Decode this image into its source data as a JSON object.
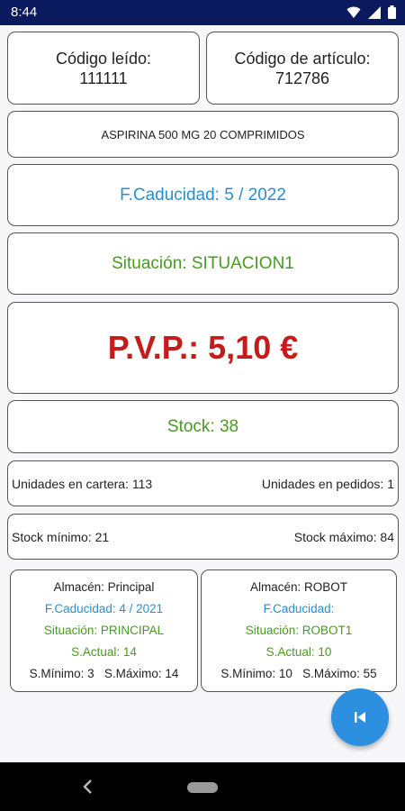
{
  "status_bar": {
    "time": "8:44",
    "icons": [
      "wifi-icon",
      "signal-icon",
      "battery-icon"
    ]
  },
  "codigo_leido": {
    "label": "Código leído:",
    "value": "111111"
  },
  "codigo_articulo": {
    "label": "Código de artículo:",
    "value": "712786"
  },
  "description": "ASPIRINA 500 MG 20 COMPRIMIDOS",
  "caducidad": "F.Caducidad: 5 / 2022",
  "situacion": "Situación: SITUACION1",
  "pvp": "P.V.P.: 5,10 €",
  "stock": "Stock: 38",
  "unidades": {
    "cartera": "Unidades en cartera: 113",
    "pedidos": "Unidades en pedidos: 1"
  },
  "stock_limits": {
    "minimo": "Stock mínimo: 21",
    "maximo": "Stock máximo: 84"
  },
  "stores": [
    {
      "almacen": "Almacén: Principal",
      "caducidad": "F.Caducidad: 4 / 2021",
      "situacion": "Situación: PRINCIPAL",
      "actual": "S.Actual: 14",
      "minmax": "S.Mínimo: 3   S.Máximo: 14"
    },
    {
      "almacen": "Almacén: ROBOT",
      "caducidad": "F.Caducidad:",
      "situacion": "Situación: ROBOT1",
      "actual": "S.Actual: 10",
      "minmax": "S.Mínimo: 10   S.Máximo: 55"
    }
  ],
  "fab": {
    "icon": "skip-previous-icon"
  },
  "colors": {
    "status_bar": "#0b1a5e",
    "blue": "#2a8fcf",
    "green": "#4a9a22",
    "red": "#c61b1b",
    "fab": "#2c8fe0"
  }
}
